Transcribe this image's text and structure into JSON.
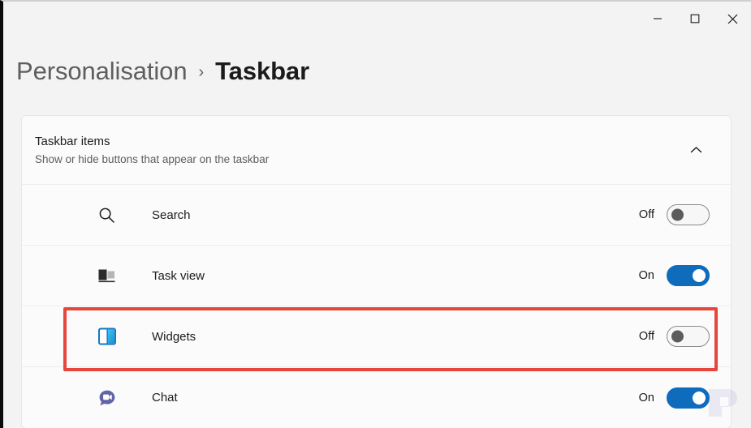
{
  "window": {
    "controls": [
      {
        "name": "minimize",
        "glyph": "minimize-icon",
        "label": "Minimise"
      },
      {
        "name": "maximize",
        "glyph": "maximize-icon",
        "label": "Maximise"
      },
      {
        "name": "close",
        "glyph": "close-icon",
        "label": "Close"
      }
    ]
  },
  "breadcrumb": {
    "parent": "Personalisation",
    "separator": "›",
    "current": "Taskbar"
  },
  "card": {
    "title": "Taskbar items",
    "subtitle": "Show or hide buttons that appear on the taskbar",
    "expand_icon": "chevron-up-icon",
    "expanded": true,
    "rows": [
      {
        "label": "Search",
        "icon": "search-icon",
        "state": "Off",
        "on": false
      },
      {
        "label": "Task view",
        "icon": "task-view-icon",
        "state": "On",
        "on": true
      },
      {
        "label": "Widgets",
        "icon": "widgets-icon",
        "state": "Off",
        "on": false,
        "highlighted": true
      },
      {
        "label": "Chat",
        "icon": "chat-icon",
        "state": "On",
        "on": true
      }
    ]
  },
  "annotation": {
    "highlight_color": "#e8453c",
    "target": "Widgets"
  },
  "watermark": {
    "glyph": "p-logo-icon"
  },
  "colors": {
    "accent": "#0f6cbd",
    "page_background": "#f3f3f3",
    "card_background": "#fbfbfb",
    "highlight": "#e8453c"
  }
}
